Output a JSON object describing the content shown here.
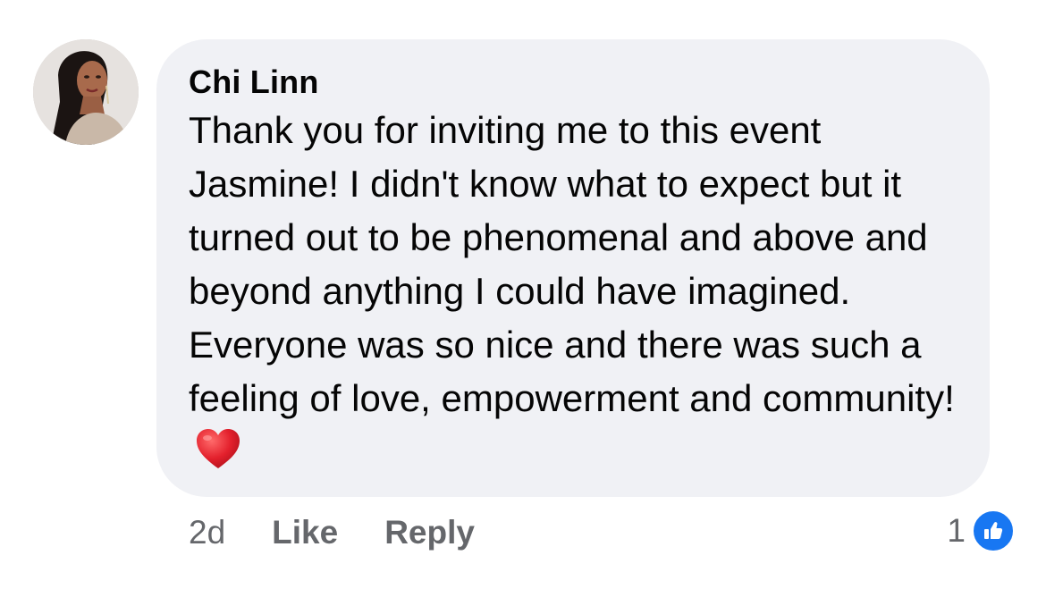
{
  "comment": {
    "author": "Chi Linn",
    "text": "Thank you for inviting me to this event Jasmine! I didn't know what to expect but it turned out to be phenomenal and above and beyond anything I could have imagined. Everyone was so nice and there was such a feeling of love, empowerment and community!",
    "emoji": "red-heart-icon",
    "avatar_icon": "profile-photo"
  },
  "actions": {
    "timestamp": "2d",
    "like_label": "Like",
    "reply_label": "Reply"
  },
  "reactions": {
    "count": "1",
    "type": "thumbs-up-icon"
  },
  "colors": {
    "bubble": "#f0f1f5",
    "text": "#050505",
    "secondary_text": "#65676b",
    "like_blue": "#1877f2",
    "heart_red": "#e0245e"
  }
}
